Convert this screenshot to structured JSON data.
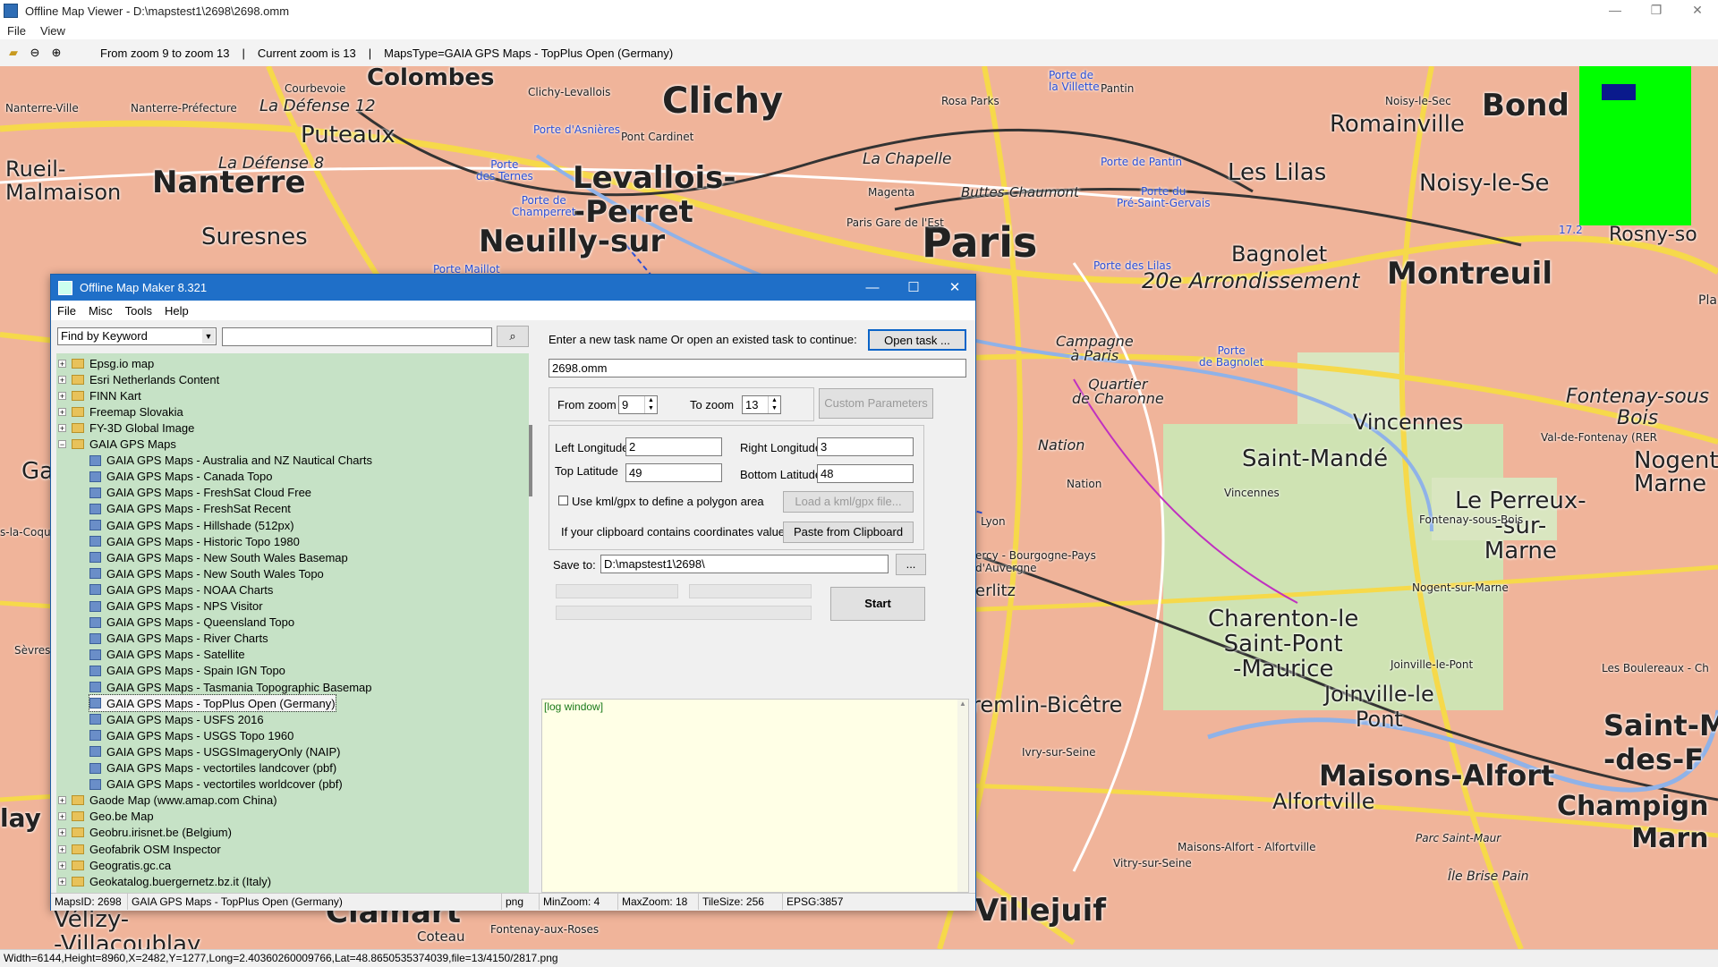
{
  "window": {
    "title": "Offline Map Viewer - D:\\mapstest1\\2698\\2698.omm",
    "controls": [
      "—",
      "❐",
      "✕"
    ]
  },
  "menu": [
    "File",
    "View"
  ],
  "toolbar": {
    "zoom_range": "From zoom 9 to zoom 13",
    "current_zoom": "Current zoom is 13",
    "maps_type": "MapsType=GAIA GPS Maps - TopPlus Open (Germany)"
  },
  "map_labels": {
    "colombes": "Colombes",
    "clichy": "Clichy",
    "bond": "Bond",
    "romainville": "Romainville",
    "puteaux": "Puteaux",
    "la_defense_12": "La Défense 12",
    "la_defense_8": "La Défense 8",
    "rueil": "Rueil-\nMalmaison",
    "nanterre": "Nanterre",
    "levallois": "Levallois-\n-Perret",
    "suresnes": "Suresnes",
    "neuilly": "Neuilly-sur",
    "paris": "Paris",
    "les_lilas": "Les Lilas",
    "noisy": "Noisy-le-Se",
    "bagnolet": "Bagnolet",
    "arr20": "20e Arrondissement",
    "montreuil": "Montreuil",
    "la_chapelle": "La Chapelle",
    "buttes": "Buttes-Chaumont",
    "fontenay": "Fontenay-sous\nBois",
    "vincennes": "Vincennes",
    "saint_mande": "Saint-Mandé",
    "nogent": "Nogent-\nMarne",
    "le_perreux": "Le Perreux-\n-sur-\nMarne",
    "charenton": "Charenton-le\nSaint-Pont\n-Maurice",
    "joinville": "Joinville-le\nPont",
    "maisons": "Maisons-Alfort",
    "alfortville": "Alfortville",
    "saint_maur": "Saint-M\n-des-F",
    "champigny": "Champign\nMarn",
    "villejuif": "Villejuif",
    "clamart": "Clamart",
    "velizy": "Vélizy-\n-Villacoublay",
    "coteau": "Coteau",
    "kremlin": "remlin-Bicêtre",
    "nation": "Nation",
    "quartier": "Quartier\nde Charonne",
    "campagne": "Campagne\nà Paris",
    "rosny": "Rosny-so",
    "nanterre_ville": "Nanterre-Ville",
    "nanterre_pref": "Nanterre-Préfecture",
    "courbevoie": "Courbevoie",
    "clichy_lev": "Clichy-Levallois",
    "magenta": "Magenta",
    "paris_est": "Paris Gare de l'Est",
    "rosa": "Rosa Parks",
    "porte_villette": "Porte de\nla Villette",
    "pantin": "Pantin",
    "noisy_sec": "Noisy-le-Sec",
    "porte_pantin": "Porte de Pantin",
    "porte_pre": "Porte du\nPré-Saint-Gervais",
    "porte_lilas": "Porte des Lilas",
    "porte_bagnolet": "Porte\nde Bagnolet",
    "porte_asnieres": "Porte d'Asnières",
    "pont_cardinet": "Pont Cardinet",
    "porte_ternes": "Porte\ndes Ternes",
    "porte_champerret": "Porte de\nChamperret",
    "porte_maillot": "Porte Maillot",
    "lyon": "Lyon",
    "bercy": "ercy - Bourgogne-Pays\nd'Auvergne",
    "erlitz": "erlitz",
    "ivry": "Ivry-sur-Seine",
    "vitry": "Vitry-sur-Seine",
    "maisons_alf": "Maisons-Alfort - Alfortville",
    "parc_st_maur": "Parc Saint-Maur",
    "ile_brise": "Île Brise Pain",
    "boulereaux": "Les Boulereaux - Ch",
    "fontenay_aux": "Fontenay-aux-Roses",
    "val_fontenay": "Val-de-Fontenay (RER",
    "fontenay_bois": "Fontenay-sous-Bois",
    "nogent_marne": "Nogent-sur-Marne",
    "joinville_pont": "Joinville-le-Pont",
    "vincennes_st": "Vincennes",
    "nation_st": "Nation",
    "sevres": "Sèvres",
    "sla_coq": "s-la-Coqu",
    "lay": "lay",
    "ga": "Ga",
    "pla": "Pla",
    "rer172": "17.2"
  },
  "dialog": {
    "title": "Offline Map Maker 8.321",
    "controls": [
      "—",
      "☐",
      "✕"
    ],
    "menu": [
      "File",
      "Misc",
      "Tools",
      "Help"
    ],
    "search": {
      "mode": "Find by Keyword",
      "query": ""
    },
    "tree": [
      {
        "label": "Epsg.io map",
        "level": 0,
        "expand": "+"
      },
      {
        "label": "Esri Netherlands Content",
        "level": 0,
        "expand": "+"
      },
      {
        "label": "FINN Kart",
        "level": 0,
        "expand": "+"
      },
      {
        "label": "Freemap Slovakia",
        "level": 0,
        "expand": "+"
      },
      {
        "label": "FY-3D Global Image",
        "level": 0,
        "expand": "+"
      },
      {
        "label": "GAIA GPS Maps",
        "level": 0,
        "expand": "−"
      },
      {
        "label": "GAIA GPS Maps - Australia and NZ Nautical Charts",
        "level": 1
      },
      {
        "label": "GAIA GPS Maps - Canada Topo",
        "level": 1
      },
      {
        "label": "GAIA GPS Maps - FreshSat Cloud Free",
        "level": 1
      },
      {
        "label": "GAIA GPS Maps - FreshSat Recent",
        "level": 1
      },
      {
        "label": "GAIA GPS Maps - Hillshade (512px)",
        "level": 1
      },
      {
        "label": "GAIA GPS Maps - Historic Topo 1980",
        "level": 1
      },
      {
        "label": "GAIA GPS Maps - New South Wales Basemap",
        "level": 1
      },
      {
        "label": "GAIA GPS Maps - New South Wales Topo",
        "level": 1
      },
      {
        "label": "GAIA GPS Maps - NOAA Charts",
        "level": 1
      },
      {
        "label": "GAIA GPS Maps - NPS Visitor",
        "level": 1
      },
      {
        "label": "GAIA GPS Maps - Queensland Topo",
        "level": 1
      },
      {
        "label": "GAIA GPS Maps - River Charts",
        "level": 1
      },
      {
        "label": "GAIA GPS Maps - Satellite",
        "level": 1
      },
      {
        "label": "GAIA GPS Maps - Spain IGN Topo",
        "level": 1
      },
      {
        "label": "GAIA GPS Maps - Tasmania Topographic Basemap",
        "level": 1
      },
      {
        "label": "GAIA GPS Maps - TopPlus Open (Germany)",
        "level": 1,
        "selected": true
      },
      {
        "label": "GAIA GPS Maps - USFS 2016",
        "level": 1
      },
      {
        "label": "GAIA GPS Maps - USGS Topo 1960",
        "level": 1
      },
      {
        "label": "GAIA GPS Maps - USGSImageryOnly (NAIP)",
        "level": 1
      },
      {
        "label": "GAIA GPS Maps - vectortiles landcover (pbf)",
        "level": 1
      },
      {
        "label": "GAIA GPS Maps - vectortiles worldcover (pbf)",
        "level": 1
      },
      {
        "label": "Gaode Map (www.amap.com China)",
        "level": 0,
        "expand": "+"
      },
      {
        "label": "Geo.be Map",
        "level": 0,
        "expand": "+"
      },
      {
        "label": "Geobru.irisnet.be (Belgium)",
        "level": 0,
        "expand": "+"
      },
      {
        "label": "Geofabrik OSM Inspector",
        "level": 0,
        "expand": "+"
      },
      {
        "label": "Geogratis.gc.ca",
        "level": 0,
        "expand": "+"
      },
      {
        "label": "Geokatalog.buergernetz.bz.it (Italy)",
        "level": 0,
        "expand": "+"
      }
    ],
    "task": {
      "prompt": "Enter a new task name Or open an existed task to continue:",
      "open_button": "Open task ...",
      "name": "2698.omm"
    },
    "zoom": {
      "from_label": "From zoom",
      "from_value": "9",
      "to_label": "To zoom",
      "to_value": "13",
      "custom_button": "Custom Parameters"
    },
    "coords": {
      "left_label": "Left Longitude",
      "left_value": "2",
      "right_label": "Right Longitude",
      "right_value": "3",
      "top_label": "Top Latitude",
      "top_value": "49",
      "bottom_label": "Bottom Latitude",
      "bottom_value": "48",
      "kml_checkbox": "Use kml/gpx to define a polygon area",
      "kml_button": "Load a kml/gpx file...",
      "clipboard_label": "If your clipboard contains coordinates values:",
      "clipboard_button": "Paste from Clipboard"
    },
    "save": {
      "label": "Save to:",
      "path": "D:\\mapstest1\\2698\\",
      "browse": "..."
    },
    "start_button": "Start",
    "log": "[log window]",
    "status": {
      "maps_id": "MapsID: 2698",
      "name": "GAIA GPS Maps - TopPlus Open (Germany)",
      "format": "png",
      "min_zoom": "MinZoom: 4",
      "max_zoom": "MaxZoom: 18",
      "tile_size": "TileSize: 256",
      "epsg": "EPSG:3857"
    }
  },
  "statusbar": "Width=6144,Height=8960,X=2482,Y=1277,Long=2.40360260009766,Lat=48.8650535374039,file=13/4150/2817.png",
  "colors": {
    "map_bg": "#f0b49a",
    "minimap": "#00ff00",
    "minimap_view": "#0a1a8c",
    "tree_bg": "#c6e2c6",
    "title_blue": "#1f6fc8"
  }
}
